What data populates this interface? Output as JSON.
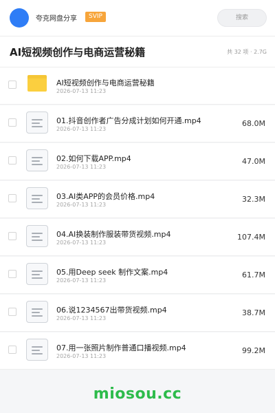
{
  "header": {
    "user_name": "夸克网盘分享",
    "vip_badge": "SVIP",
    "search_placeholder": "搜索"
  },
  "share": {
    "title": "AI短视频创作与电商运营秘籍",
    "stats": "共 32 项 · 2.7G"
  },
  "files": [
    {
      "type": "folder",
      "name": "AI短视频创作与电商运营秘籍",
      "date": "2026-07-13 11:23",
      "size": ""
    },
    {
      "type": "file",
      "name": "01.抖音创作者广告分成计划如何开通.mp4",
      "date": "2026-07-13 11:23",
      "size": "68.0M"
    },
    {
      "type": "file",
      "name": "02.如何下载APP.mp4",
      "date": "2026-07-13 11:23",
      "size": "47.0M"
    },
    {
      "type": "file",
      "name": "03.AI类APP的会员价格.mp4",
      "date": "2026-07-13 11:23",
      "size": "32.3M"
    },
    {
      "type": "file",
      "name": "04.AI换装制作服装带货视频.mp4",
      "date": "2026-07-13 11:23",
      "size": "107.4M"
    },
    {
      "type": "file",
      "name": "05.用Deep seek 制作文案.mp4",
      "date": "2026-07-13 11:23",
      "size": "61.7M"
    },
    {
      "type": "file",
      "name": "06.说1234567出带货视频.mp4",
      "date": "2026-07-13 11:23",
      "size": "38.7M"
    },
    {
      "type": "file",
      "name": "07.用一张照片制作普通口播视频.mp4",
      "date": "2026-07-13 11:23",
      "size": "99.2M"
    }
  ],
  "watermark": "miosou.cc",
  "colors": {
    "accent": "#2f7df6",
    "vip": "#f7a53b",
    "folder": "#fbcf3f",
    "watermark": "#2dbb4b"
  }
}
